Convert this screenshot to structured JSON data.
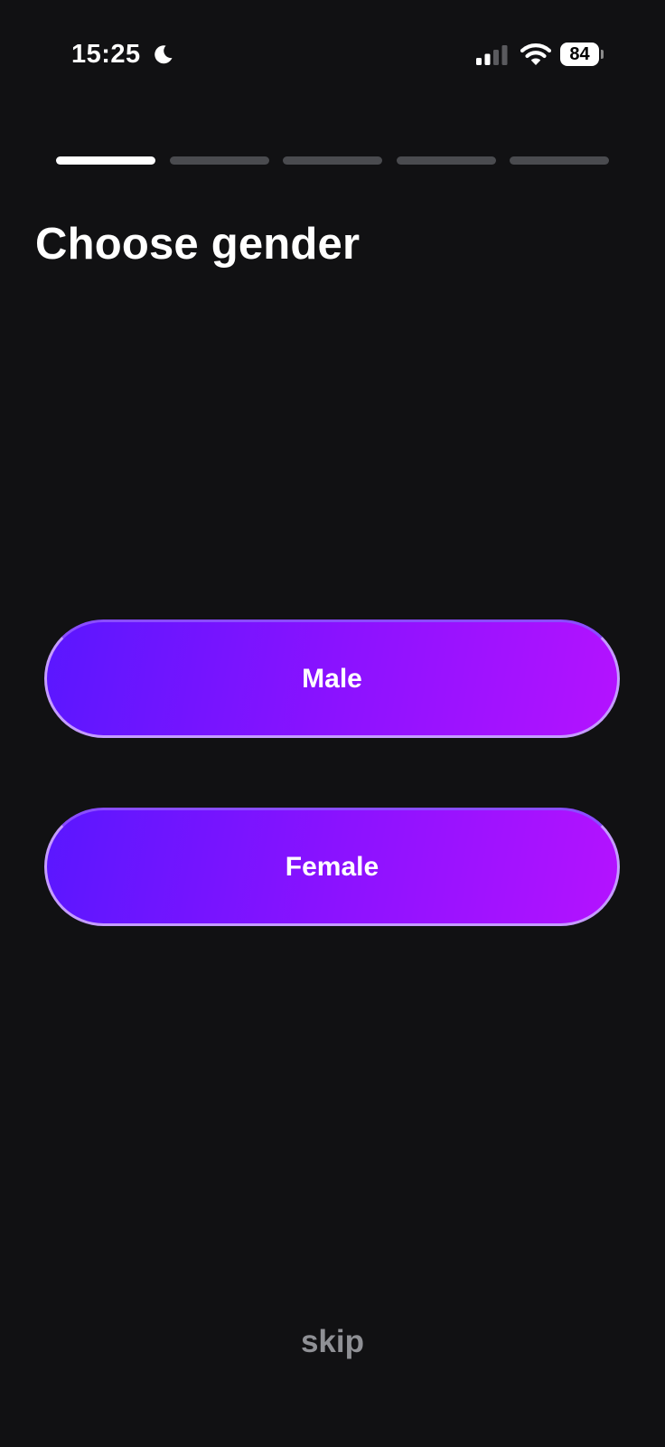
{
  "status_bar": {
    "time": "15:25",
    "battery_level": "84",
    "icons": [
      "moon-icon",
      "signal-icon",
      "wifi-icon",
      "battery-icon"
    ]
  },
  "progress": {
    "total_steps": 5,
    "current_step": 1
  },
  "title": "Choose gender",
  "options": [
    {
      "label": "Male"
    },
    {
      "label": "Female"
    }
  ],
  "skip_label": "skip",
  "colors": {
    "background": "#111113",
    "button_gradient_start": "#5a17ff",
    "button_gradient_end": "#b412ff",
    "button_border": "#c59cff",
    "progress_active": "#ffffff",
    "progress_inactive": "#4a4b4f",
    "skip_text": "#8f9095"
  }
}
